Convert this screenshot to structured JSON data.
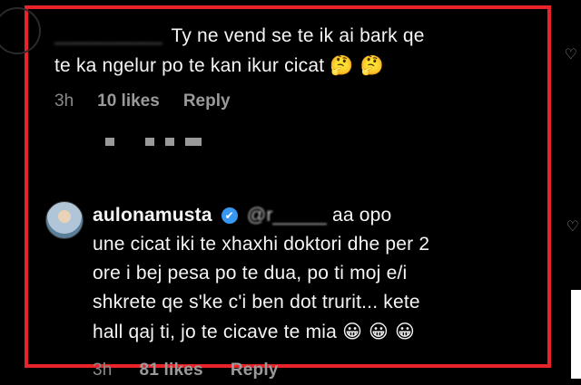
{
  "comment1": {
    "username_blurred": "__________",
    "text_line1": "Ty ne vend se te ik ai bark qe",
    "text_line2": "te ka ngelur po te kan ikur cicat",
    "emojis": "🤔 🤔",
    "time": "3h",
    "likes": "10 likes",
    "reply": "Reply"
  },
  "reply1": {
    "username": "aulonamusta",
    "verified_mark": "✔",
    "mention_blurred": "@r_____",
    "text_start": "aa opo",
    "lines": [
      "une cicat iki te xhaxhi doktori dhe per 2",
      "ore i bej pesa po te dua, po ti moj e/i",
      "shkrete qe s'ke c'i ben dot trurit... kete",
      "hall qaj ti, jo te cicave te mia"
    ],
    "emojis": "😀 😀 😀",
    "time": "3h",
    "likes": "81 likes",
    "reply": "Reply"
  },
  "colors": {
    "frame": "#e8242a",
    "verified": "#3897f0"
  }
}
